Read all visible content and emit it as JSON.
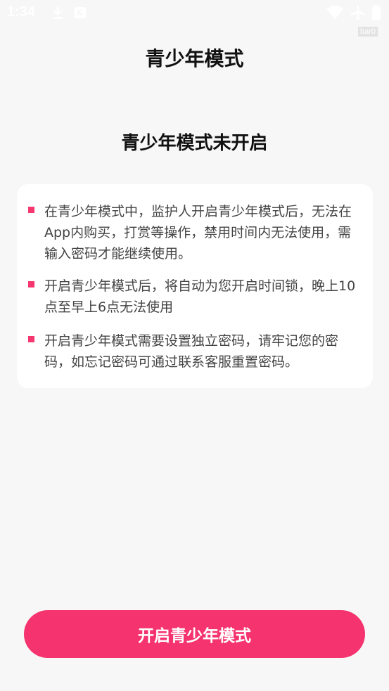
{
  "status_bar": {
    "time": "1:34",
    "debug_tag": "bar0",
    "icons": [
      "download-icon",
      "notification-icon",
      "wifi-icon",
      "airplane-icon",
      "battery-icon"
    ]
  },
  "header": {
    "title": "青少年模式"
  },
  "main": {
    "status_text": "青少年模式未开启",
    "info_items": [
      {
        "text": "在青少年模式中，监护人开启青少年模式后，无法在App内购买，打赏等操作，禁用时间内无法使用，需输入密码才能继续使用。"
      },
      {
        "text": "开启青少年模式后，将自动为您开启时间锁，晚上10点至早上6点无法使用"
      },
      {
        "text": "开启青少年模式需要设置独立密码，请牢记您的密码，如忘记密码可通过联系客服重置密码。"
      }
    ]
  },
  "footer": {
    "button_label": "开启青少年模式"
  },
  "colors": {
    "accent": "#f5336f",
    "background": "#f7f7f7",
    "card": "#ffffff",
    "title_text": "#111111",
    "body_text": "#444444"
  }
}
